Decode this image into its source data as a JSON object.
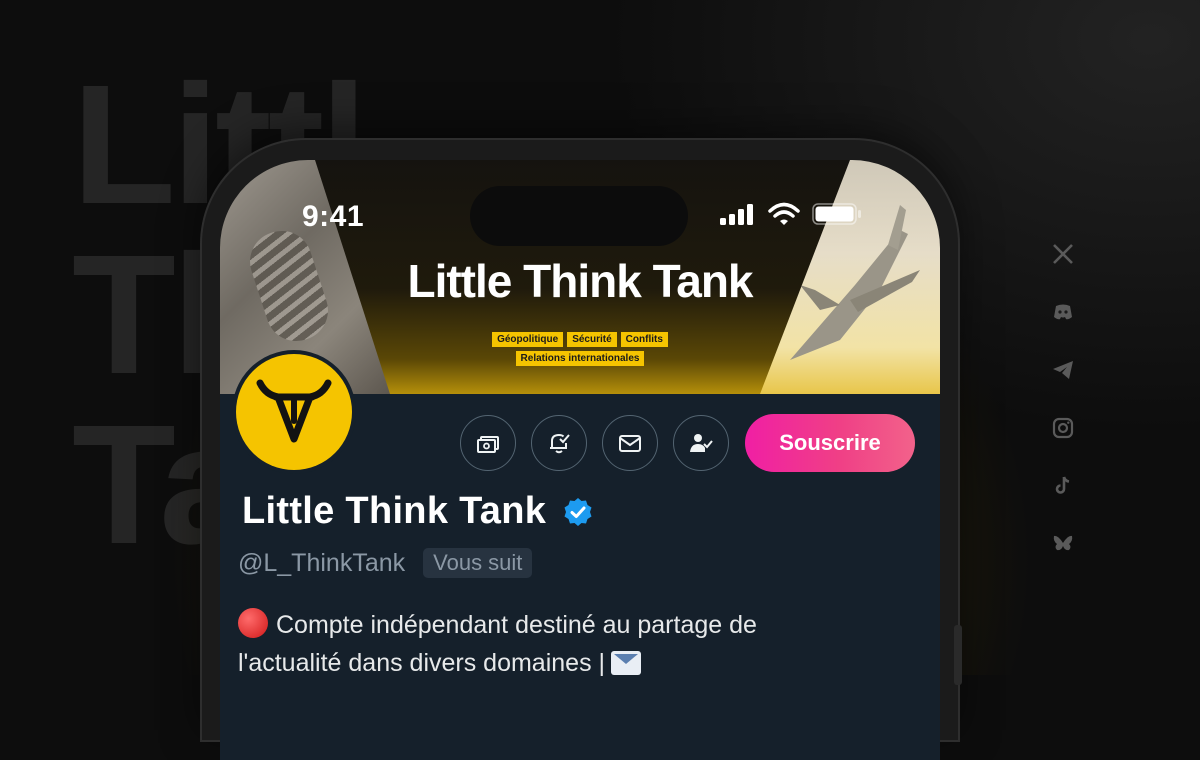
{
  "background": {
    "title_lines": [
      "Littl",
      "Thi",
      "Tank"
    ]
  },
  "status_bar": {
    "time": "9:41"
  },
  "banner": {
    "title": "Little Think Tank",
    "tags_row1": [
      "Géopolitique",
      "Sécurité",
      "Conflits"
    ],
    "tags_row2": [
      "Relations internationales"
    ]
  },
  "profile": {
    "name": "Little Think Tank",
    "handle": "@L_ThinkTank",
    "follows_badge": "Vous suit",
    "bio_line1": "Compte indépendant destiné au partage de",
    "bio_line2": "l'actualité dans divers domaines |",
    "subscribe_label": "Souscrire"
  },
  "social_icons": [
    "x-icon",
    "discord-icon",
    "telegram-icon",
    "instagram-icon",
    "tiktok-icon",
    "bluesky-icon"
  ],
  "colors": {
    "accent_yellow": "#f5c400",
    "subscribe_pink": "#f01fa4",
    "verified_blue": "#1d9bf0",
    "screen_bg": "#15202b"
  }
}
